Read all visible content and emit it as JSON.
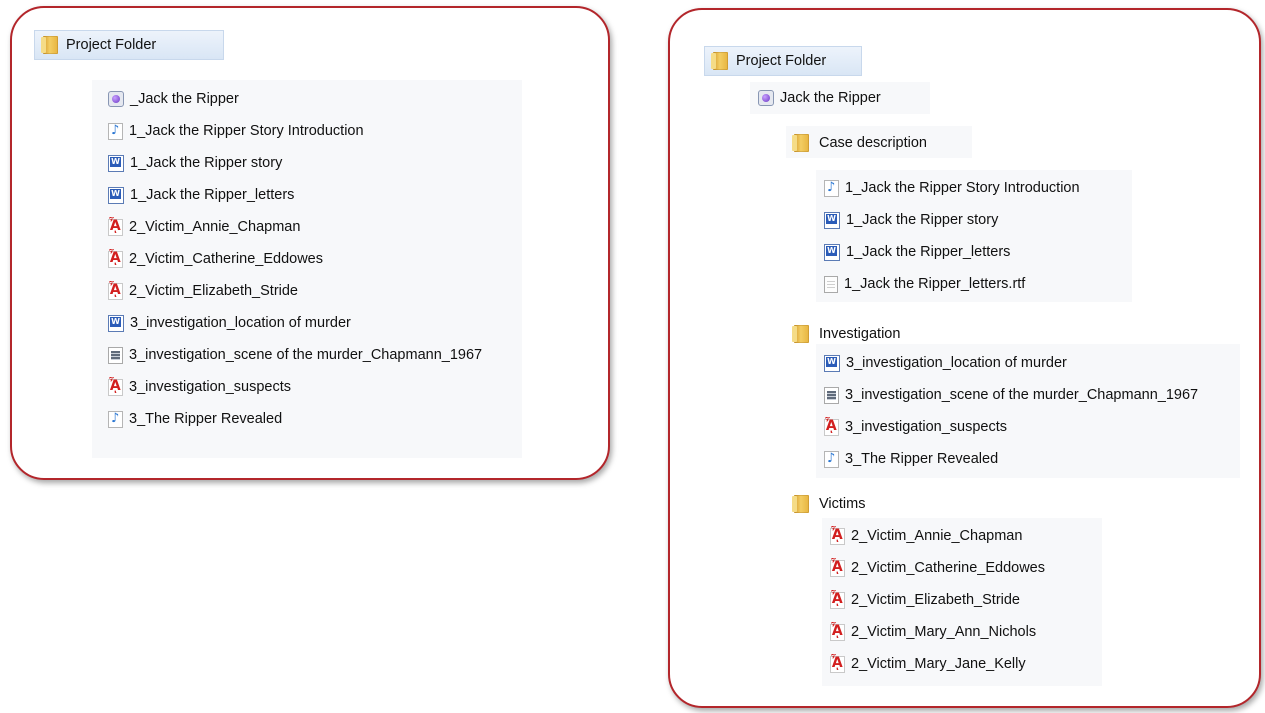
{
  "left_panel": {
    "header": {
      "icon": "folder-icon",
      "label": "Project Folder"
    },
    "items": [
      {
        "icon": "app-icon",
        "label": "_Jack the Ripper"
      },
      {
        "icon": "audio-file-icon",
        "label": "1_Jack the Ripper Story Introduction"
      },
      {
        "icon": "word-file-icon",
        "label": "1_Jack the Ripper story"
      },
      {
        "icon": "word-file-icon",
        "label": "1_Jack the Ripper_letters"
      },
      {
        "icon": "pdf-file-icon",
        "label": "2_Victim_Annie_Chapman"
      },
      {
        "icon": "pdf-file-icon",
        "label": "2_Victim_Catherine_Eddowes"
      },
      {
        "icon": "pdf-file-icon",
        "label": "2_Victim_Elizabeth_Stride"
      },
      {
        "icon": "word-file-icon",
        "label": "3_investigation_location of murder"
      },
      {
        "icon": "image-file-icon",
        "label": "3_investigation_scene of the murder_Chapmann_1967"
      },
      {
        "icon": "pdf-file-icon",
        "label": "3_investigation_suspects"
      },
      {
        "icon": "audio-file-icon",
        "label": "3_The Ripper Revealed"
      }
    ]
  },
  "right_panel": {
    "header": {
      "icon": "folder-icon",
      "label": "Project Folder"
    },
    "project": {
      "icon": "app-icon",
      "label": "Jack the Ripper"
    },
    "folders": [
      {
        "name": "Case description",
        "icon": "folder-icon",
        "items": [
          {
            "icon": "audio-file-icon",
            "label": "1_Jack the Ripper Story Introduction"
          },
          {
            "icon": "word-file-icon",
            "label": "1_Jack the Ripper story"
          },
          {
            "icon": "word-file-icon",
            "label": "1_Jack the Ripper_letters"
          },
          {
            "icon": "text-file-icon",
            "label": "1_Jack the Ripper_letters.rtf"
          }
        ]
      },
      {
        "name": "Investigation",
        "icon": "folder-icon",
        "items": [
          {
            "icon": "word-file-icon",
            "label": "3_investigation_location of murder"
          },
          {
            "icon": "image-file-icon",
            "label": "3_investigation_scene of the murder_Chapmann_1967"
          },
          {
            "icon": "pdf-file-icon",
            "label": "3_investigation_suspects"
          },
          {
            "icon": "audio-file-icon",
            "label": "3_The Ripper Revealed"
          }
        ]
      },
      {
        "name": "Victims",
        "icon": "folder-icon",
        "items": [
          {
            "icon": "pdf-file-icon",
            "label": "2_Victim_Annie_Chapman"
          },
          {
            "icon": "pdf-file-icon",
            "label": "2_Victim_Catherine_Eddowes"
          },
          {
            "icon": "pdf-file-icon",
            "label": "2_Victim_Elizabeth_Stride"
          },
          {
            "icon": "pdf-file-icon",
            "label": "2_Victim_Mary_Ann_Nichols"
          },
          {
            "icon": "pdf-file-icon",
            "label": "2_Victim_Mary_Jane_Kelly"
          }
        ]
      }
    ]
  },
  "colors": {
    "panel_border": "#b3262b",
    "header_bg": "#dce8f5",
    "list_bg": "#f7f8fa"
  }
}
